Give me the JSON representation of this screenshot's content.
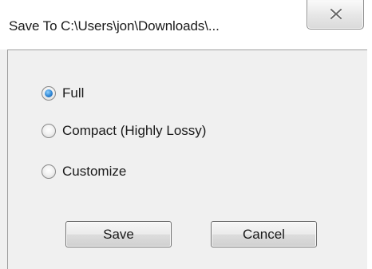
{
  "window": {
    "title": "Save To C:\\Users\\jon\\Downloads\\...",
    "close_icon": "close-x"
  },
  "options": [
    {
      "label": "Full",
      "checked": true
    },
    {
      "label": "Compact (Highly Lossy)",
      "checked": false
    },
    {
      "label": "Customize",
      "checked": false
    }
  ],
  "buttons": {
    "save_label": "Save",
    "cancel_label": "Cancel"
  },
  "colors": {
    "radio_selected": "#2e86d4",
    "dialog_background": "#f0f0f0"
  }
}
